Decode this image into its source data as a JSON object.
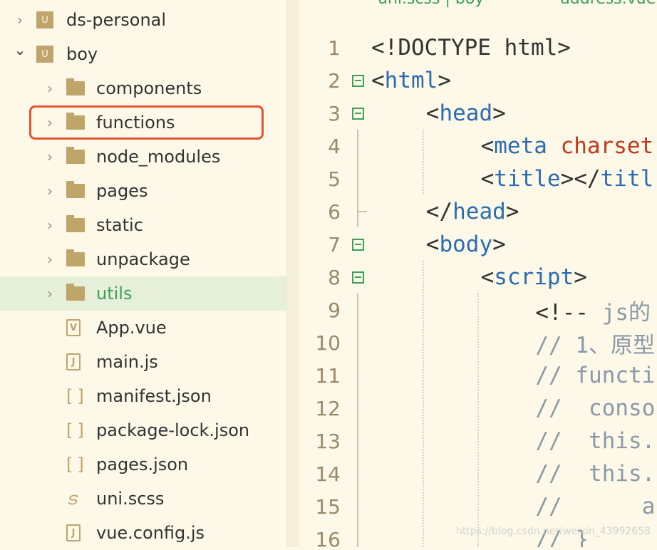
{
  "sidebar": {
    "items": [
      {
        "label": "ds-personal",
        "type": "project",
        "expanded": false,
        "depth": 0
      },
      {
        "label": "boy",
        "type": "project",
        "expanded": true,
        "depth": 0
      },
      {
        "label": "components",
        "type": "folder",
        "depth": 1
      },
      {
        "label": "functions",
        "type": "folder",
        "depth": 1,
        "highlighted": true
      },
      {
        "label": "node_modules",
        "type": "folder",
        "depth": 1
      },
      {
        "label": "pages",
        "type": "folder",
        "depth": 1
      },
      {
        "label": "static",
        "type": "folder",
        "depth": 1
      },
      {
        "label": "unpackage",
        "type": "folder",
        "depth": 1
      },
      {
        "label": "utils",
        "type": "folder",
        "depth": 1,
        "selected": true
      },
      {
        "label": "App.vue",
        "type": "vue-file",
        "icon_glyph": "V",
        "depth": 1
      },
      {
        "label": "main.js",
        "type": "js-file",
        "icon_glyph": "J",
        "depth": 1
      },
      {
        "label": "manifest.json",
        "type": "json-file",
        "icon_glyph": "[ ]",
        "depth": 1
      },
      {
        "label": "package-lock.json",
        "type": "json-file",
        "icon_glyph": "[ ]",
        "depth": 1
      },
      {
        "label": "pages.json",
        "type": "json-file",
        "icon_glyph": "[ ]",
        "depth": 1
      },
      {
        "label": "uni.scss",
        "type": "scss-file",
        "icon_glyph": "S",
        "depth": 1
      },
      {
        "label": "vue.config.js",
        "type": "js-file",
        "icon_glyph": "J",
        "depth": 1
      }
    ],
    "project_icon_glyph": "U"
  },
  "tabs": [
    "uni.scss | boy",
    "address.vue"
  ],
  "colors": {
    "highlight_border": "#e4552d",
    "accent_green": "#3aa156",
    "tag_blue": "#2b6cb0",
    "attr_red": "#c0391b",
    "comment_gray": "#8a9aa6"
  },
  "code": [
    {
      "n": "1",
      "indent": 0,
      "tokens": [
        [
          "p",
          "<!DOCTYPE html>"
        ]
      ]
    },
    {
      "n": "2",
      "fold": true,
      "indent": 0,
      "tokens": [
        [
          "p",
          "<"
        ],
        [
          "t",
          "html"
        ],
        [
          "p",
          ">"
        ]
      ]
    },
    {
      "n": "3",
      "fold": true,
      "indent": 4,
      "tokens": [
        [
          "p",
          "<"
        ],
        [
          "t",
          "head"
        ],
        [
          "p",
          ">"
        ]
      ]
    },
    {
      "n": "4",
      "indent": 8,
      "tokens": [
        [
          "p",
          "<"
        ],
        [
          "t",
          "meta"
        ],
        [
          "p",
          " "
        ],
        [
          "a",
          "charset"
        ]
      ]
    },
    {
      "n": "5",
      "indent": 8,
      "tokens": [
        [
          "p",
          "<"
        ],
        [
          "t",
          "title"
        ],
        [
          "p",
          "></"
        ],
        [
          "t",
          "titl"
        ]
      ]
    },
    {
      "n": "6",
      "indent": 4,
      "tokens": [
        [
          "p",
          "</"
        ],
        [
          "t",
          "head"
        ],
        [
          "p",
          ">"
        ]
      ]
    },
    {
      "n": "7",
      "fold": true,
      "indent": 4,
      "tokens": [
        [
          "p",
          "<"
        ],
        [
          "t",
          "body"
        ],
        [
          "p",
          ">"
        ]
      ]
    },
    {
      "n": "8",
      "fold": true,
      "indent": 8,
      "tokens": [
        [
          "p",
          "<"
        ],
        [
          "t",
          "script"
        ],
        [
          "p",
          ">"
        ]
      ]
    },
    {
      "n": "9",
      "indent": 12,
      "tokens": [
        [
          "p",
          "<!-- "
        ],
        [
          "c",
          "js的"
        ]
      ]
    },
    {
      "n": "10",
      "indent": 12,
      "tokens": [
        [
          "c",
          "// 1、原型"
        ]
      ]
    },
    {
      "n": "11",
      "indent": 12,
      "tokens": [
        [
          "c",
          "// functi"
        ]
      ]
    },
    {
      "n": "12",
      "indent": 12,
      "tokens": [
        [
          "c",
          "//  conso"
        ]
      ]
    },
    {
      "n": "13",
      "indent": 12,
      "tokens": [
        [
          "c",
          "//  this."
        ]
      ]
    },
    {
      "n": "14",
      "indent": 12,
      "tokens": [
        [
          "c",
          "//  this."
        ]
      ]
    },
    {
      "n": "15",
      "indent": 12,
      "tokens": [
        [
          "c",
          "//      a"
        ]
      ]
    },
    {
      "n": "16",
      "indent": 12,
      "tokens": [
        [
          "c",
          "// }"
        ]
      ]
    }
  ],
  "watermark": "https://blog.csdn.net/weixin_43992658"
}
